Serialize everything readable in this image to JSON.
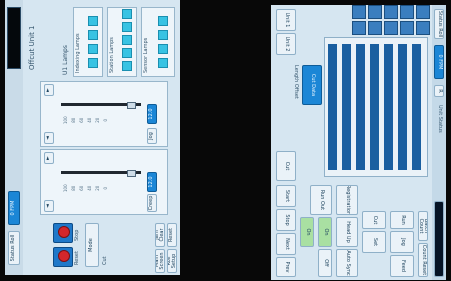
{
  "left_panel": {
    "title": "Offcut Unit 1",
    "subtitle": "U1 Lamps",
    "lamp_groups": [
      {
        "caption": "Indexing Lamps",
        "lamps": [
          "",
          "",
          "",
          ""
        ]
      },
      {
        "caption": "Station Lamps",
        "lamps": [
          "",
          "",
          "",
          "",
          ""
        ]
      },
      {
        "caption": "Sensor Lamps",
        "lamps": [
          "",
          "",
          "",
          ""
        ]
      }
    ],
    "top_button": "Status Roll",
    "blue_label": "0  FPM",
    "slider_top": {
      "side_label": "Jog",
      "value": "12.0",
      "ticks": [
        "100",
        "80",
        "60",
        "40",
        "20",
        "0"
      ],
      "arrow_left": "◄",
      "arrow_right": "►"
    },
    "slider_bottom": {
      "side_label": "Creep",
      "value": "12.0",
      "ticks": [
        "100",
        "80",
        "60",
        "40",
        "20",
        "0"
      ],
      "arrow_left": "◄",
      "arrow_right": "►"
    },
    "bottom_buttons": [
      "Main Screen",
      "Roll Setup",
      "Jam Clear",
      "Reset"
    ],
    "reset_label": "Reset",
    "stop_label": "Stop",
    "rightside_label": "Cut",
    "check_text": "Mode"
  },
  "right_panel": {
    "status_button": "Status Roll",
    "blue_label": "0  FPM",
    "small_button": "R",
    "top_label": "Unit Status",
    "mode_tabs": [
      "Batch Count",
      "Count Reset"
    ],
    "side_button_top": "Cut",
    "actions": [
      "Start",
      "Stop",
      "Next",
      "Prev"
    ],
    "options": [
      "Registration",
      "Head Up",
      "Auto Sync",
      "Run Out"
    ],
    "left_col": [
      "Run",
      "Jog",
      "Feed",
      "Cut",
      "Set"
    ],
    "checks": [
      "On",
      "Off",
      "On"
    ],
    "blue_box": "Cut Data",
    "small_text": "Length Offset",
    "bottom_buttons": [
      "Unit 1",
      "Unit 2"
    ]
  }
}
